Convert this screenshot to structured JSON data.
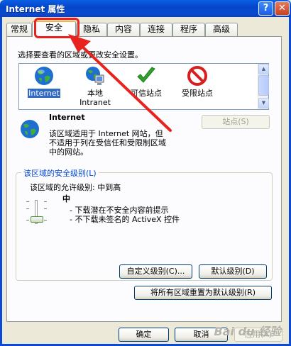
{
  "window": {
    "title": "Internet 属性",
    "help": "?",
    "close": "✕"
  },
  "tabs": [
    {
      "label": "常规"
    },
    {
      "label": "安全"
    },
    {
      "label": "隐私"
    },
    {
      "label": "内容"
    },
    {
      "label": "连接"
    },
    {
      "label": "程序"
    },
    {
      "label": "高级"
    }
  ],
  "security": {
    "instruction": "选择要查看的区域或更改安全设置。",
    "zones": [
      {
        "name": "Internet",
        "icon": "globe-icon"
      },
      {
        "name": "本地\nIntranet",
        "icon": "intranet-icon"
      },
      {
        "name": "可信站点",
        "icon": "checkmark-icon"
      },
      {
        "name": "受限站点",
        "icon": "restricted-icon"
      }
    ],
    "zone_title": "Internet",
    "zone_desc_1": "该区域适用于 Internet 网站，但",
    "zone_desc_2": "不适用于列在受信任和受限制区域",
    "zone_desc_3": "中的网站。",
    "sites_button": "站点(S)",
    "group_title": "该区域的安全级别(L)",
    "allowed_level": "该区域的允许级别: 中到高",
    "level_name": "中",
    "level_bullet_1": "- 下载潜在不安全内容前提示",
    "level_bullet_2": "- 不下载未签名的 ActiveX 控件",
    "custom_button": "自定义级别(C)...",
    "default_button": "默认级别(D)",
    "reset_button": "将所有区域重置为默认级别(R)"
  },
  "footer": {
    "ok": "确定",
    "cancel": "取消",
    "apply": "应用(A)"
  },
  "watermark": "Bai du 经验",
  "colors": {
    "annotation": "#e8221e",
    "titlebar": "#0a5fe5",
    "selection": "#316ac5"
  }
}
